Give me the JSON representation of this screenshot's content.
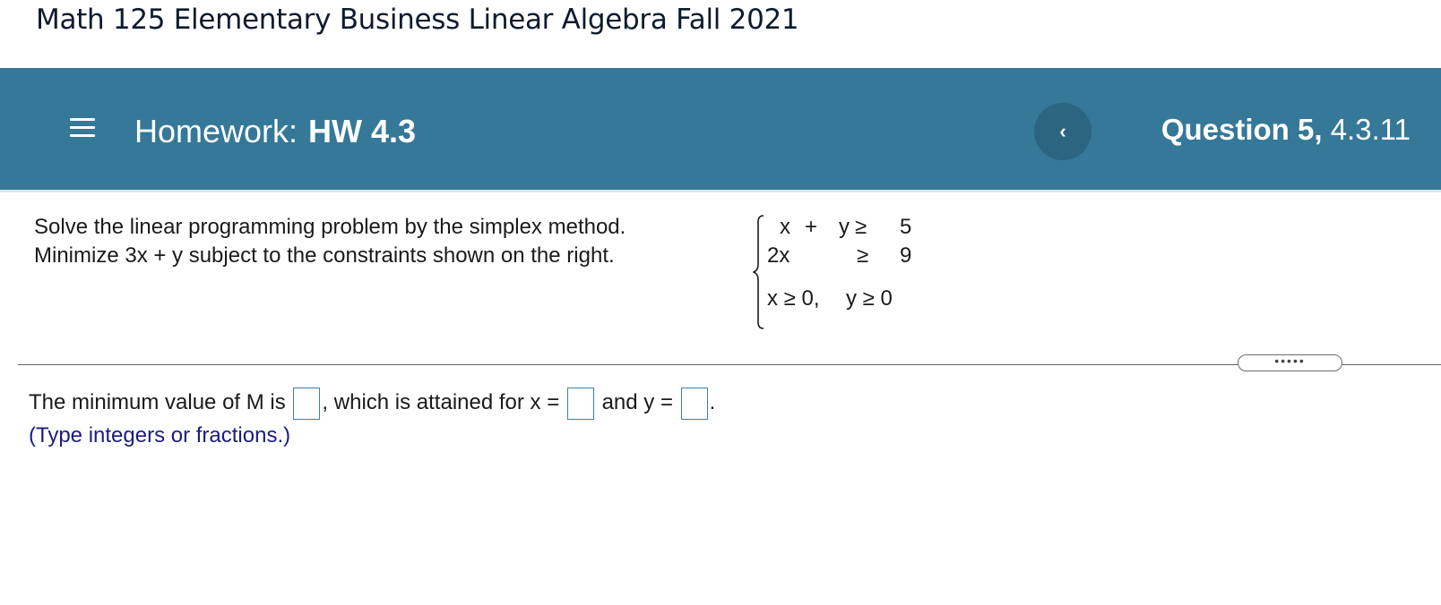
{
  "course": {
    "title": "Math 125 Elementary Business Linear Algebra Fall 2021"
  },
  "homework": {
    "label": "Homework:",
    "name": "HW 4.3"
  },
  "navigation": {
    "prev_symbol": "‹"
  },
  "question": {
    "number": "Question 5,",
    "id": "4.3.11"
  },
  "problem": {
    "line1": "Solve the linear programming problem by the simplex method.",
    "line2": "Minimize 3x + y subject to the constraints shown on the right."
  },
  "constraints": {
    "row1": {
      "a": "x",
      "plus": "+",
      "b": "y",
      "rel": "≥",
      "rhs": "5"
    },
    "row2": {
      "a": "2x",
      "rel": "≥",
      "rhs": "9"
    },
    "nonneg": {
      "x": "x ≥ 0,",
      "y": "y ≥ 0"
    }
  },
  "more_button": {
    "label": "•••••"
  },
  "answer": {
    "part1": "The minimum value of M is",
    "part2": ", which is attained for x =",
    "part3": "and y =",
    "part4": ".",
    "hint": "(Type integers or fractions.)",
    "m_value": "",
    "x_value": "",
    "y_value": ""
  },
  "colors": {
    "banner": "#357897",
    "answer_box_border": "#3a7fb3",
    "hint_text": "#1c1c7d"
  }
}
